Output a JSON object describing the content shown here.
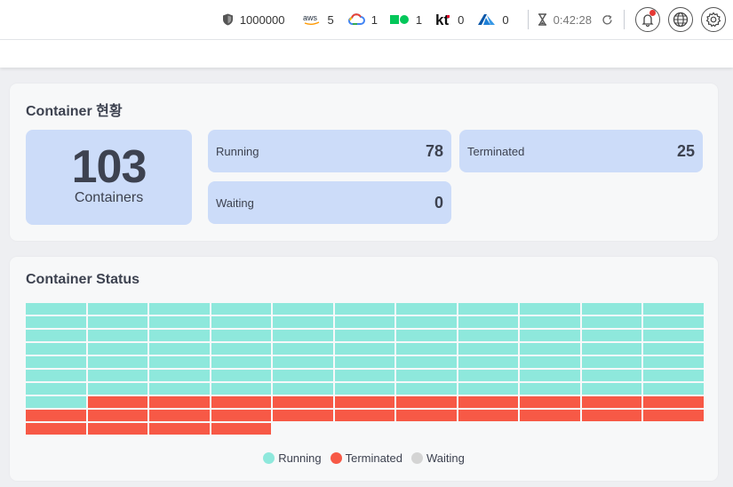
{
  "topbar": {
    "credit_value": "1000000",
    "providers": [
      {
        "name": "aws",
        "icon": "aws-logo-icon",
        "count": "5"
      },
      {
        "name": "gcp",
        "icon": "google-cloud-icon",
        "count": "1"
      },
      {
        "name": "naver",
        "icon": "naver-cloud-icon",
        "count": "1"
      },
      {
        "name": "kt",
        "icon": "kt-logo-icon",
        "count": "0"
      },
      {
        "name": "azure",
        "icon": "azure-icon",
        "count": "0"
      }
    ],
    "timer": "0:42:28"
  },
  "summary": {
    "title": "Container 현황",
    "total_value": "103",
    "total_label": "Containers",
    "running_label": "Running",
    "running_value": "78",
    "terminated_label": "Terminated",
    "terminated_value": "25",
    "waiting_label": "Waiting",
    "waiting_value": "0"
  },
  "status": {
    "title": "Container Status",
    "columns": 11,
    "running": 78,
    "terminated": 25,
    "waiting": 0
  },
  "legend": {
    "running": "Running",
    "terminated": "Terminated",
    "waiting": "Waiting"
  },
  "colors": {
    "running": "#8ee8dc",
    "terminated": "#f75946",
    "waiting": "#d4d4d4",
    "stat_box": "#ccdcf9"
  }
}
